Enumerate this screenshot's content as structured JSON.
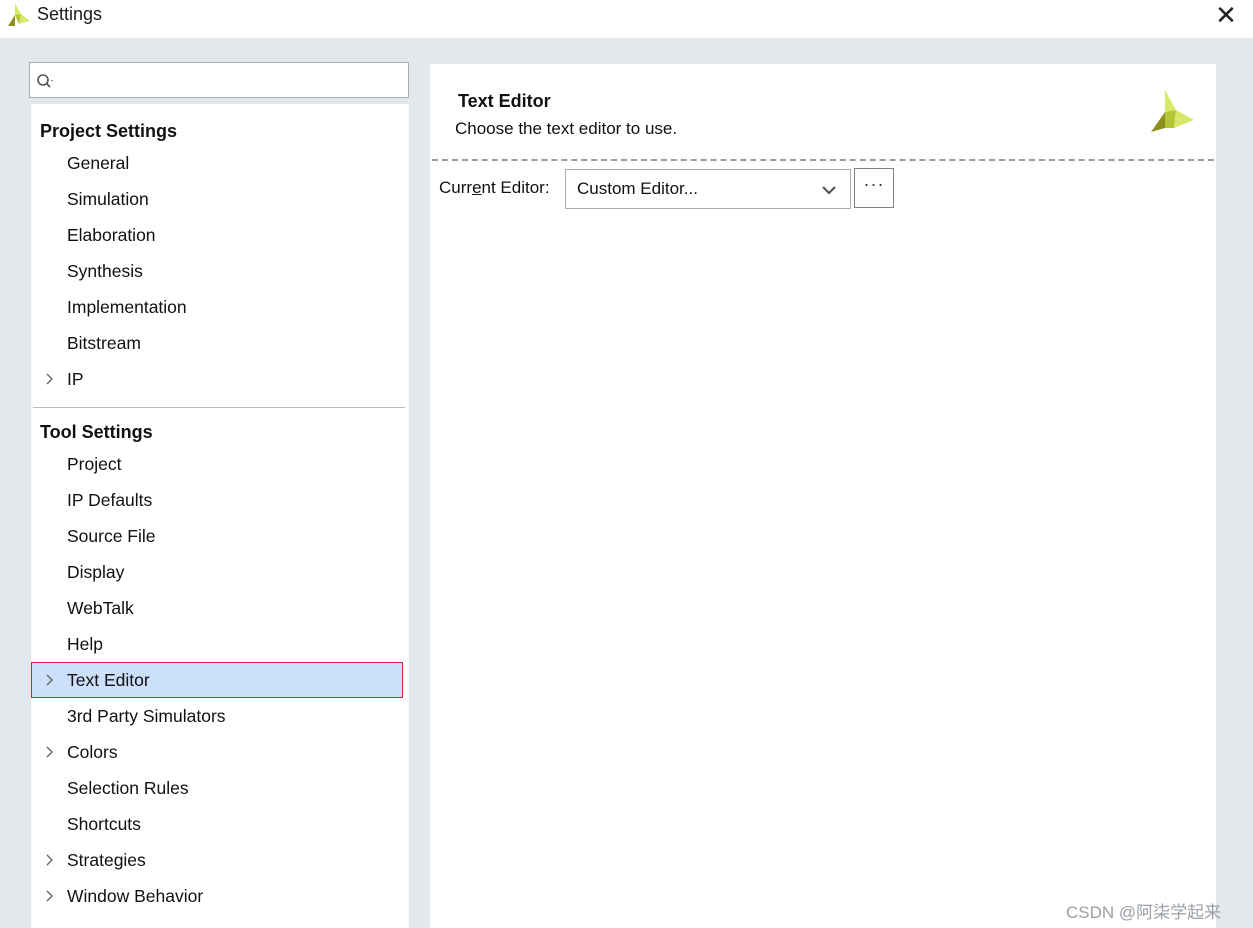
{
  "window": {
    "title": "Settings",
    "close_glyph": "✕"
  },
  "search": {
    "value": "",
    "placeholder": ""
  },
  "tree": {
    "project_settings": {
      "header": "Project Settings",
      "items": [
        {
          "label": "General",
          "expandable": false
        },
        {
          "label": "Simulation",
          "expandable": false
        },
        {
          "label": "Elaboration",
          "expandable": false
        },
        {
          "label": "Synthesis",
          "expandable": false
        },
        {
          "label": "Implementation",
          "expandable": false
        },
        {
          "label": "Bitstream",
          "expandable": false
        },
        {
          "label": "IP",
          "expandable": true
        }
      ]
    },
    "tool_settings": {
      "header": "Tool Settings",
      "items": [
        {
          "label": "Project",
          "expandable": false
        },
        {
          "label": "IP Defaults",
          "expandable": false
        },
        {
          "label": "Source File",
          "expandable": false
        },
        {
          "label": "Display",
          "expandable": false
        },
        {
          "label": "WebTalk",
          "expandable": false
        },
        {
          "label": "Help",
          "expandable": false
        },
        {
          "label": "Text Editor",
          "expandable": true,
          "selected": true
        },
        {
          "label": "3rd Party Simulators",
          "expandable": false
        },
        {
          "label": "Colors",
          "expandable": true
        },
        {
          "label": "Selection Rules",
          "expandable": false
        },
        {
          "label": "Shortcuts",
          "expandable": false
        },
        {
          "label": "Strategies",
          "expandable": true
        },
        {
          "label": "Window Behavior",
          "expandable": true
        }
      ]
    }
  },
  "panel": {
    "title": "Text Editor",
    "description": "Choose the text editor to use.",
    "current_editor_label_pre": "Curr",
    "current_editor_label_mnemonic": "e",
    "current_editor_label_post": "nt Editor:",
    "current_editor_value": "Custom Editor...",
    "browse_label": "···"
  },
  "watermark": "CSDN @阿柒学起来",
  "colors": {
    "selection_bg": "#cce0fb",
    "selection_outline": "#e0202a",
    "chrome_bg": "#e4e7ec",
    "logo_light": "#d7e86a",
    "logo_dark": "#8c8f1c"
  },
  "icons": {
    "app": "vivado-logo-icon",
    "search": "search-icon",
    "close": "close-icon",
    "expand": "chevron-right-icon",
    "dropdown": "chevron-down-icon"
  }
}
